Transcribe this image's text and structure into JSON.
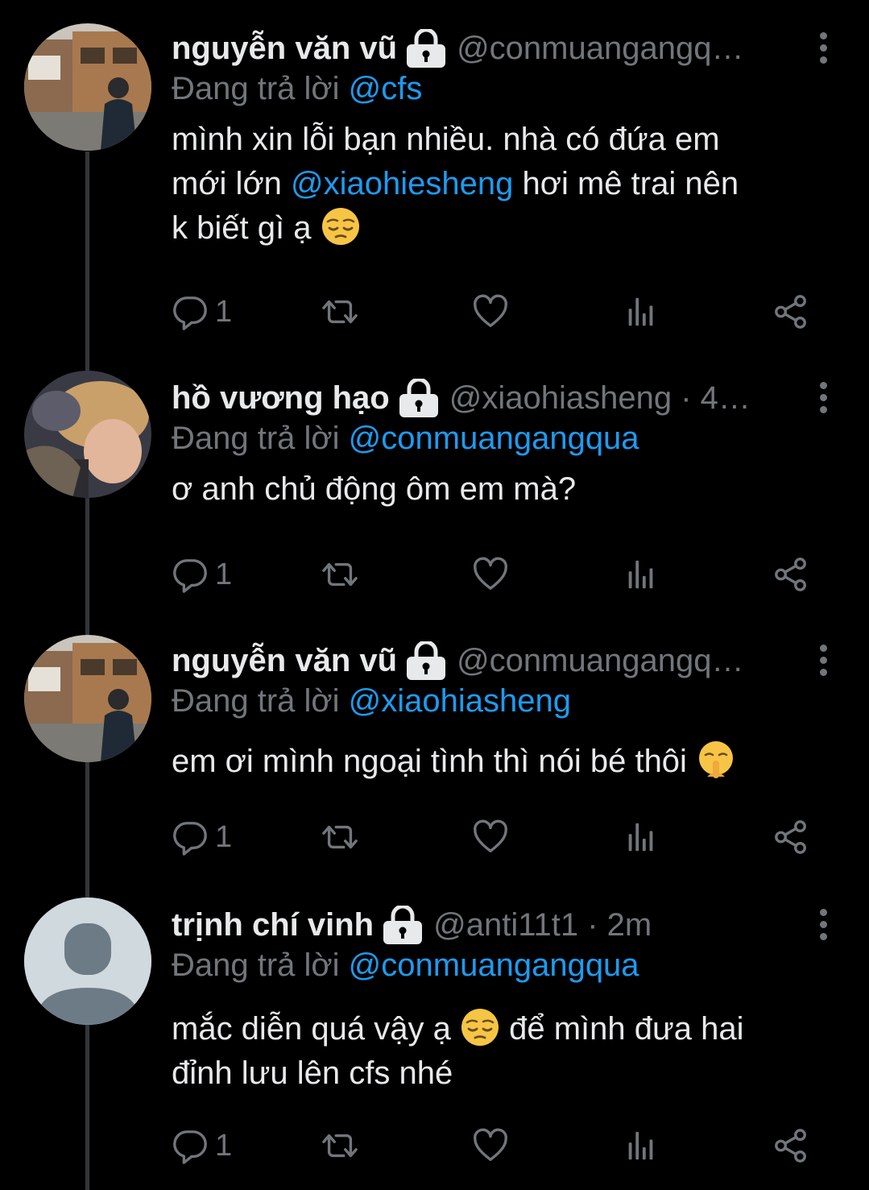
{
  "tweets": [
    {
      "name": "nguyễn văn vũ",
      "handle": "@conmuangangq…",
      "reply_prefix": "Đang trả lời",
      "reply_to": "@cfs",
      "text_a": "mình xin lỗi bạn nhiều. nhà có đứa em",
      "text_b_pre": "mới lớn ",
      "text_b_mention": "@xiaohiesheng",
      "text_b_post": " hơi mê trai nên",
      "text_c": "k biết gì ạ ",
      "reply_count": "1",
      "avatar": "photo-avatar-house"
    },
    {
      "name": "hồ vương hạo",
      "handle": "@xiaohiasheng · 4…",
      "reply_prefix": "Đang trả lời",
      "reply_to": "@conmuangangqua",
      "text": "ơ anh chủ động ôm em mà?",
      "reply_count": "1",
      "avatar": "photo-avatar-person"
    },
    {
      "name": "nguyễn văn vũ",
      "handle": "@conmuangangq…",
      "reply_prefix": "Đang trả lời",
      "reply_to": "@xiaohiasheng",
      "text": "em ơi mình ngoại tình thì nói bé thôi ",
      "reply_count": "1",
      "avatar": "photo-avatar-house"
    },
    {
      "name": "trịnh chí vinh",
      "handle": "@anti11t1 · 2m",
      "reply_prefix": "Đang trả lời",
      "reply_to": "@conmuangangqua",
      "text_a": "mắc diễn quá vậy ạ ",
      "text_a_post": " để mình đưa hai",
      "text_b": "đỉnh lưu lên cfs nhé",
      "reply_count": "1",
      "avatar": "default-avatar"
    }
  ],
  "colors": {
    "background": "#000000",
    "text": "#e7e9ea",
    "muted": "#71767b",
    "link": "#1d9bf0",
    "thread_line": "#333639"
  },
  "icons": [
    "lock-icon",
    "more-icon",
    "reply-icon",
    "retweet-icon",
    "like-icon",
    "views-icon",
    "share-icon",
    "pensive-emoji",
    "shushing-emoji"
  ]
}
